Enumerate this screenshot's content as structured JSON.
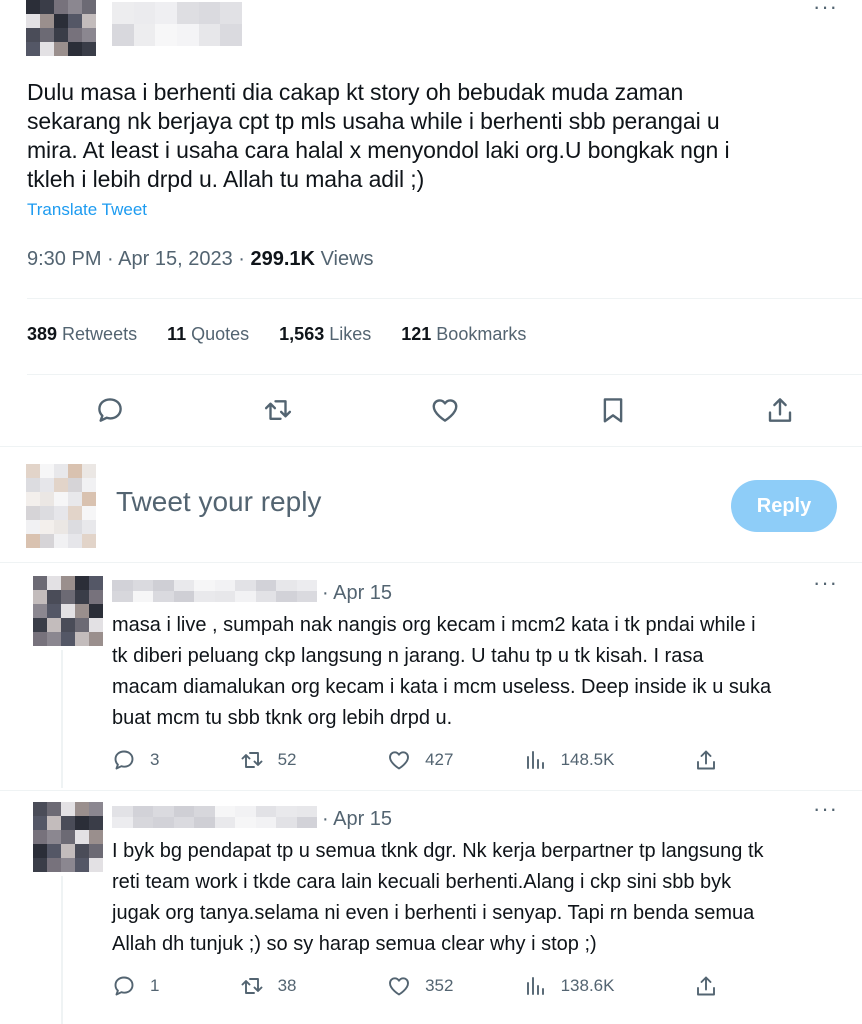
{
  "tweet": {
    "text": "Dulu masa i berhenti dia cakap kt story oh bebudak muda zaman\nsekarang nk berjaya cpt tp mls usaha while i berhenti sbb perangai u\nmira. At least i usaha cara halal x menyondol laki org.U bongkak ngn i\ntkleh i lebih drpd u. Allah tu maha adil ;)",
    "translate_label": "Translate Tweet",
    "time": "9:30 PM",
    "date": "Apr 15, 2023",
    "separator": "·",
    "views_count": "299.1K",
    "views_label": "Views",
    "more_icon": "···",
    "stats": {
      "retweets_count": "389",
      "retweets_label": "Retweets",
      "quotes_count": "11",
      "quotes_label": "Quotes",
      "likes_count": "1,563",
      "likes_label": "Likes",
      "bookmarks_count": "121",
      "bookmarks_label": "Bookmarks"
    },
    "actions": [
      "reply-icon",
      "retweet-icon",
      "like-icon",
      "bookmark-icon",
      "share-icon"
    ]
  },
  "reply_composer": {
    "placeholder": "Tweet your reply",
    "button_label": "Reply",
    "button_color": "#8ecdf8"
  },
  "replies": [
    {
      "date": "· Apr 15",
      "text": "masa i live , sumpah nak nangis org kecam i mcm2 kata i tk pndai while i\ntk diberi peluang ckp langsung n jarang. U tahu tp u tk kisah. I rasa\nmacam diamalukan org kecam i kata i mcm useless. Deep inside ik u suka\nbuat mcm tu sbb tknk org lebih drpd u.",
      "replies": "3",
      "retweets": "52",
      "likes": "427",
      "views": "148.5K"
    },
    {
      "date": "· Apr 15",
      "text": "I byk bg pendapat tp u semua tknk dgr. Nk kerja berpartner tp langsung tk\nreti team work i tkde cara lain kecuali berhenti.Alang i ckp sini sbb byk\njugak org tanya.selama ni even i berhenti i senyap. Tapi rn benda semua\nAllah dh tunjuk ;) so sy harap semua clear why i stop ;)",
      "replies": "1",
      "retweets": "38",
      "likes": "352",
      "views": "138.6K"
    }
  ],
  "colors": {
    "accent": "#1d9bf0",
    "text_primary": "#0f1419",
    "text_secondary": "#536471",
    "divider": "#eff3f4"
  }
}
